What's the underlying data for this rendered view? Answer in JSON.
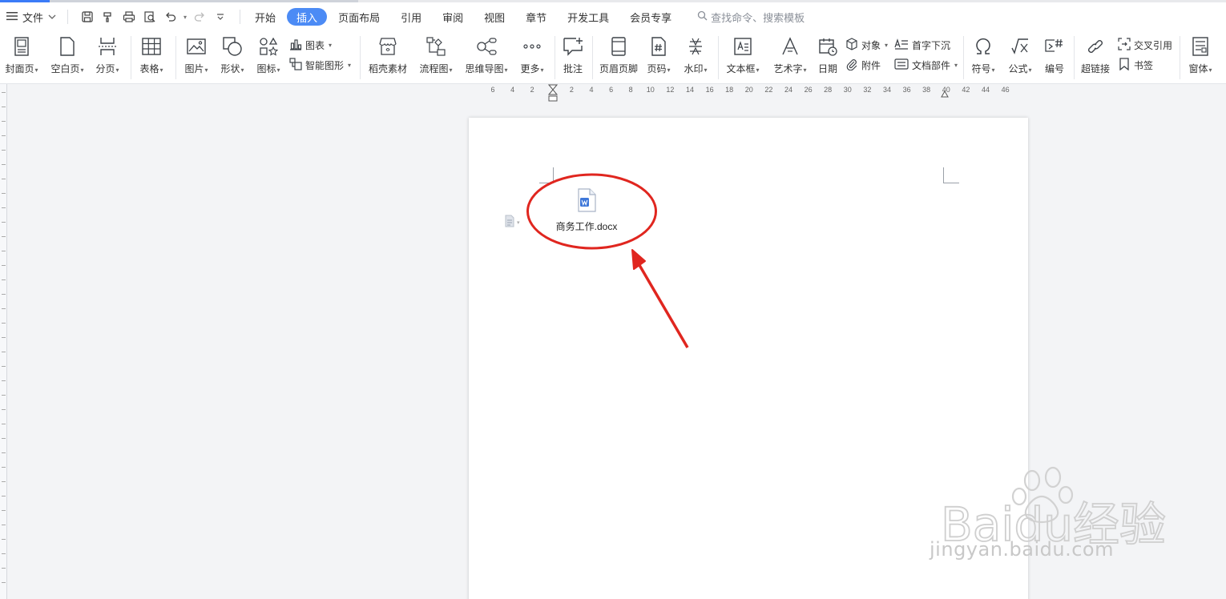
{
  "menubar": {
    "file_label": "文件",
    "tabs": [
      {
        "label": "开始",
        "active": false
      },
      {
        "label": "插入",
        "active": true
      },
      {
        "label": "页面布局",
        "active": false
      },
      {
        "label": "引用",
        "active": false
      },
      {
        "label": "审阅",
        "active": false
      },
      {
        "label": "视图",
        "active": false
      },
      {
        "label": "章节",
        "active": false
      },
      {
        "label": "开发工具",
        "active": false
      },
      {
        "label": "会员专享",
        "active": false
      }
    ],
    "search_placeholder": "查找命令、搜索模板"
  },
  "ribbon": {
    "cover": "封面页",
    "blank": "空白页",
    "pagebreak": "分页",
    "table": "表格",
    "picture": "图片",
    "shape": "形状",
    "icon": "图标",
    "chart": "图表",
    "smartart": "智能图形",
    "material": "稻壳素材",
    "flowchart": "流程图",
    "mindmap": "思维导图",
    "more": "更多",
    "comment": "批注",
    "headerfooter": "页眉页脚",
    "pagenum": "页码",
    "watermark": "水印",
    "textbox": "文本框",
    "wordart": "艺术字",
    "date": "日期",
    "object": "对象",
    "attachment": "附件",
    "dropcap": "首字下沉",
    "docpart": "文档部件",
    "symbol": "符号",
    "formula": "公式",
    "numbering": "编号",
    "hyperlink": "超链接",
    "crossref": "交叉引用",
    "bookmark": "书签",
    "window": "窗体"
  },
  "ruler": [
    "6",
    "4",
    "2",
    "",
    "2",
    "4",
    "6",
    "8",
    "10",
    "12",
    "14",
    "16",
    "18",
    "20",
    "22",
    "24",
    "26",
    "28",
    "30",
    "32",
    "34",
    "36",
    "38",
    "40",
    "42",
    "44",
    "46"
  ],
  "document": {
    "attachment_name": "商务工作.docx"
  },
  "annotation": {
    "color": "#e0261f"
  },
  "watermark": {
    "text": "jingyan.baidu.com",
    "brand": "Baidu经验"
  },
  "colors": {
    "accent": "#4c8bf5",
    "icon": "#3d4248"
  }
}
